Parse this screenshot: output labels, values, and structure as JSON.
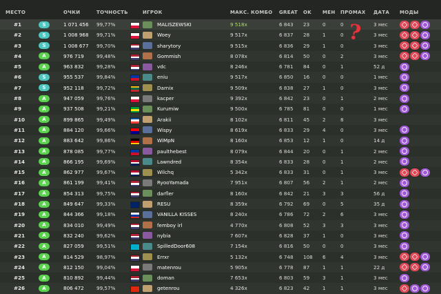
{
  "header": {
    "rank": "МЕСТО",
    "score": "ОЧКИ",
    "accuracy": "ТОЧНОСТЬ",
    "player": "ИГРОК",
    "max_combo": "МАКС. КОМБО",
    "great": "GREAT",
    "ok": "OK",
    "meh": "МЕН",
    "miss": "ПРОМАХ",
    "date": "ДАТА",
    "mods": "МОДЫ"
  },
  "annotation": "?",
  "colors": {
    "grade_S": "#4dc7c0",
    "grade_A": "#5ad24e",
    "mod_hr": "#e04a58",
    "mod_dt": "#a05ad8",
    "fc_combo": "#a9e05a",
    "annotation": "#e8323c"
  },
  "rows": [
    {
      "rank": "#1",
      "grade": "S",
      "score": "1 071 456",
      "acc": "99,77%",
      "flag": "PL",
      "player": "MALISZEWSKI",
      "combo": "9 518x",
      "fc": true,
      "great": "6 843",
      "ok": "23",
      "meh": "0",
      "miss": "0",
      "date": "3 мес",
      "mods": [
        "hr",
        "hr",
        "dt"
      ]
    },
    {
      "rank": "#2",
      "grade": "S",
      "score": "1 008 968",
      "acc": "99,71%",
      "flag": "PL",
      "player": "Woey",
      "combo": "9 517x",
      "fc": false,
      "great": "6 837",
      "ok": "28",
      "meh": "1",
      "miss": "0",
      "date": "3 мес",
      "mods": [
        "hr",
        "hr",
        "dt"
      ]
    },
    {
      "rank": "#3",
      "grade": "S",
      "score": "1 008 677",
      "acc": "99,70%",
      "flag": "US",
      "player": "sharytory",
      "combo": "9 515x",
      "fc": false,
      "great": "6 836",
      "ok": "29",
      "meh": "1",
      "miss": "0",
      "date": "3 мес",
      "mods": [
        "hr",
        "hr",
        "dt"
      ]
    },
    {
      "rank": "#4",
      "grade": "A",
      "score": "976 719",
      "acc": "99,48%",
      "flag": "US",
      "player": "Gommish",
      "combo": "8 078x",
      "fc": false,
      "great": "6 814",
      "ok": "50",
      "meh": "0",
      "miss": "2",
      "date": "3 мес",
      "mods": [
        "hr",
        "hr",
        "dt"
      ]
    },
    {
      "rank": "#5",
      "grade": "A",
      "score": "963 832",
      "acc": "99,28%",
      "flag": "US",
      "player": "vdc",
      "combo": "8 246x",
      "fc": false,
      "great": "6 781",
      "ok": "84",
      "meh": "0",
      "miss": "1",
      "date": "52 д",
      "mods": [
        "dt"
      ]
    },
    {
      "rank": "#6",
      "grade": "S",
      "score": "955 537",
      "acc": "99,84%",
      "flag": "PH",
      "player": "eniu",
      "combo": "9 517x",
      "fc": false,
      "great": "6 850",
      "ok": "16",
      "meh": "0",
      "miss": "0",
      "date": "1 мес",
      "mods": [
        "dt"
      ]
    },
    {
      "rank": "#7",
      "grade": "S",
      "score": "952 118",
      "acc": "99,72%",
      "flag": "LT",
      "player": "Darnix",
      "combo": "9 509x",
      "fc": false,
      "great": "6 838",
      "ok": "27",
      "meh": "1",
      "miss": "0",
      "date": "3 мес",
      "mods": [
        "dt"
      ]
    },
    {
      "rank": "#8",
      "grade": "A",
      "score": "947 059",
      "acc": "99,76%",
      "flag": "PL",
      "player": "kacper",
      "combo": "9 392x",
      "fc": false,
      "great": "6 842",
      "ok": "23",
      "meh": "0",
      "miss": "1",
      "date": "2 мес",
      "mods": [
        "dt"
      ]
    },
    {
      "rank": "#9",
      "grade": "A",
      "score": "937 508",
      "acc": "99,21%",
      "flag": "BR",
      "player": "Kurumiw",
      "combo": "9 500x",
      "fc": false,
      "great": "6 785",
      "ok": "81",
      "meh": "0",
      "miss": "0",
      "date": "1 мес",
      "mods": [
        "dt"
      ]
    },
    {
      "rank": "#10",
      "grade": "A",
      "score": "899 865",
      "acc": "99,49%",
      "flag": "FR",
      "player": "Arakii",
      "combo": "8 102x",
      "fc": false,
      "great": "6 811",
      "ok": "45",
      "meh": "2",
      "miss": "8",
      "date": "3 мес",
      "mods": []
    },
    {
      "rank": "#11",
      "grade": "A",
      "score": "884 120",
      "acc": "99,66%",
      "flag": "TW",
      "player": "Wispy",
      "combo": "8 619x",
      "fc": false,
      "great": "6 833",
      "ok": "29",
      "meh": "4",
      "miss": "0",
      "date": "3 мес",
      "mods": [
        "dt"
      ]
    },
    {
      "rank": "#12",
      "grade": "A",
      "score": "883 642",
      "acc": "99,86%",
      "flag": "DE",
      "player": "WiMpN",
      "combo": "8 160x",
      "fc": false,
      "great": "6 853",
      "ok": "12",
      "meh": "1",
      "miss": "0",
      "date": "14 д",
      "mods": [
        "dt"
      ]
    },
    {
      "rank": "#13",
      "grade": "A",
      "score": "878 085",
      "acc": "99,77%",
      "flag": "PH",
      "player": "paulthebest",
      "combo": "8 079x",
      "fc": false,
      "great": "6 844",
      "ok": "20",
      "meh": "0",
      "miss": "1",
      "date": "2 мес",
      "mods": [
        "dt"
      ]
    },
    {
      "rank": "#14",
      "grade": "A",
      "score": "866 195",
      "acc": "99,69%",
      "flag": "NO",
      "player": "Lawndred",
      "combo": "8 354x",
      "fc": false,
      "great": "6 833",
      "ok": "28",
      "meh": "0",
      "miss": "1",
      "date": "2 мес",
      "mods": [
        "dt"
      ]
    },
    {
      "rank": "#15",
      "grade": "A",
      "score": "862 977",
      "acc": "99,67%",
      "flag": "NO",
      "player": "Wilchq",
      "combo": "5 342x",
      "fc": false,
      "great": "6 833",
      "ok": "31",
      "meh": "0",
      "miss": "1",
      "date": "3 мес",
      "mods": [
        "hr",
        "hr",
        "dt"
      ]
    },
    {
      "rank": "#16",
      "grade": "A",
      "score": "861 199",
      "acc": "99,41%",
      "flag": "US",
      "player": "RyooYamada",
      "combo": "7 951x",
      "fc": false,
      "great": "6 807",
      "ok": "56",
      "meh": "2",
      "miss": "1",
      "date": "2 мес",
      "mods": [
        "dt"
      ]
    },
    {
      "rank": "#17",
      "grade": "A",
      "score": "854 313",
      "acc": "99,75%",
      "flag": "US",
      "player": "darfler",
      "combo": "8 160x",
      "fc": false,
      "great": "6 842",
      "ok": "21",
      "meh": "3",
      "miss": "3",
      "date": "56 д",
      "mods": [
        "dt"
      ]
    },
    {
      "rank": "#18",
      "grade": "A",
      "score": "849 647",
      "acc": "99,33%",
      "flag": "AU",
      "player": "RESU",
      "combo": "8 359x",
      "fc": false,
      "great": "6 792",
      "ok": "69",
      "meh": "0",
      "miss": "5",
      "date": "35 д",
      "mods": [
        "dt"
      ]
    },
    {
      "rank": "#19",
      "grade": "A",
      "score": "844 366",
      "acc": "99,18%",
      "flag": "RU",
      "player": "VANILLA KISSES",
      "combo": "8 240x",
      "fc": false,
      "great": "6 786",
      "ok": "72",
      "meh": "2",
      "miss": "6",
      "date": "3 мес",
      "mods": [
        "dt"
      ]
    },
    {
      "rank": "#20",
      "grade": "A",
      "score": "834 010",
      "acc": "99,49%",
      "flag": "US",
      "player": "femboy irl",
      "combo": "4 770x",
      "fc": false,
      "great": "6 808",
      "ok": "52",
      "meh": "3",
      "miss": "3",
      "date": "3 мес",
      "mods": [
        "dt"
      ]
    },
    {
      "rank": "#21",
      "grade": "A",
      "score": "832 240",
      "acc": "99,62%",
      "flag": "US",
      "player": "nybia",
      "combo": "7 607x",
      "fc": false,
      "great": "6 828",
      "ok": "37",
      "meh": "1",
      "miss": "0",
      "date": "3 мес",
      "mods": [
        "dt"
      ]
    },
    {
      "rank": "#22",
      "grade": "A",
      "score": "827 059",
      "acc": "99,51%",
      "flag": "KZ",
      "player": "SpilledDoor608",
      "combo": "7 154x",
      "fc": false,
      "great": "6 816",
      "ok": "50",
      "meh": "0",
      "miss": "0",
      "date": "3 мес",
      "mods": [
        "dt"
      ]
    },
    {
      "rank": "#23",
      "grade": "A",
      "score": "814 529",
      "acc": "98,97%",
      "flag": "US",
      "player": "Errxr",
      "combo": "5 132x",
      "fc": false,
      "great": "6 748",
      "ok": "108",
      "meh": "6",
      "miss": "4",
      "date": "3 мес",
      "mods": [
        "hr",
        "hr",
        "dt"
      ]
    },
    {
      "rank": "#24",
      "grade": "A",
      "score": "812 150",
      "acc": "99,04%",
      "flag": "PL",
      "player": "matenrou",
      "combo": "5 905x",
      "fc": false,
      "great": "6 778",
      "ok": "87",
      "meh": "1",
      "miss": "1",
      "date": "22 д",
      "mods": [
        "hr",
        "hr",
        "dt"
      ]
    },
    {
      "rank": "#25",
      "grade": "A",
      "score": "810 892",
      "acc": "99,44%",
      "flag": "US",
      "player": "doman",
      "combo": "7 653x",
      "fc": false,
      "great": "6 803",
      "ok": "59",
      "meh": "3",
      "miss": "1",
      "date": "3 мес",
      "mods": [
        "dt"
      ]
    },
    {
      "rank": "#26",
      "grade": "A",
      "score": "806 472",
      "acc": "99,57%",
      "flag": "CN",
      "player": "getenrou",
      "combo": "4 326x",
      "fc": false,
      "great": "6 823",
      "ok": "42",
      "meh": "1",
      "miss": "1",
      "date": "3 мес",
      "mods": [
        "hr",
        "dt",
        "dt"
      ]
    }
  ]
}
